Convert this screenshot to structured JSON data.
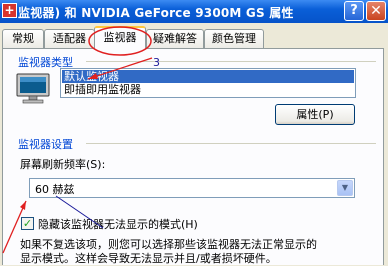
{
  "window": {
    "title": "监视器) 和 NVIDIA GeForce 9300M GS 属性",
    "help_label": "?",
    "close_label": "✕"
  },
  "tabs": [
    {
      "label": "常规"
    },
    {
      "label": "适配器"
    },
    {
      "label": "监视器"
    },
    {
      "label": "疑难解答"
    },
    {
      "label": "颜色管理"
    }
  ],
  "monitor_type": {
    "group_title": "监视器类型",
    "items": [
      {
        "label": "默认监视器",
        "selected": true
      },
      {
        "label": "即插即用监视器",
        "selected": false
      }
    ],
    "properties_button": "属性(P)"
  },
  "monitor_settings": {
    "group_title": "监视器设置",
    "refresh_label": "屏幕刷新频率(S):",
    "refresh_value": "60 赫兹",
    "hide_modes_checked": true,
    "hide_modes_label": "隐藏该监视器无法显示的模式(H)",
    "description_line1": "如果不复选该项，则您可以选择那些该监视器无法正常显示的",
    "description_line2": "显示模式。这样会导致无法显示并且/或者损坏硬件。"
  },
  "annotations": {
    "step3_label": "3"
  },
  "colors": {
    "annotation": "#e02020",
    "selection": "#316ac5",
    "group_title": "#0046d5"
  }
}
